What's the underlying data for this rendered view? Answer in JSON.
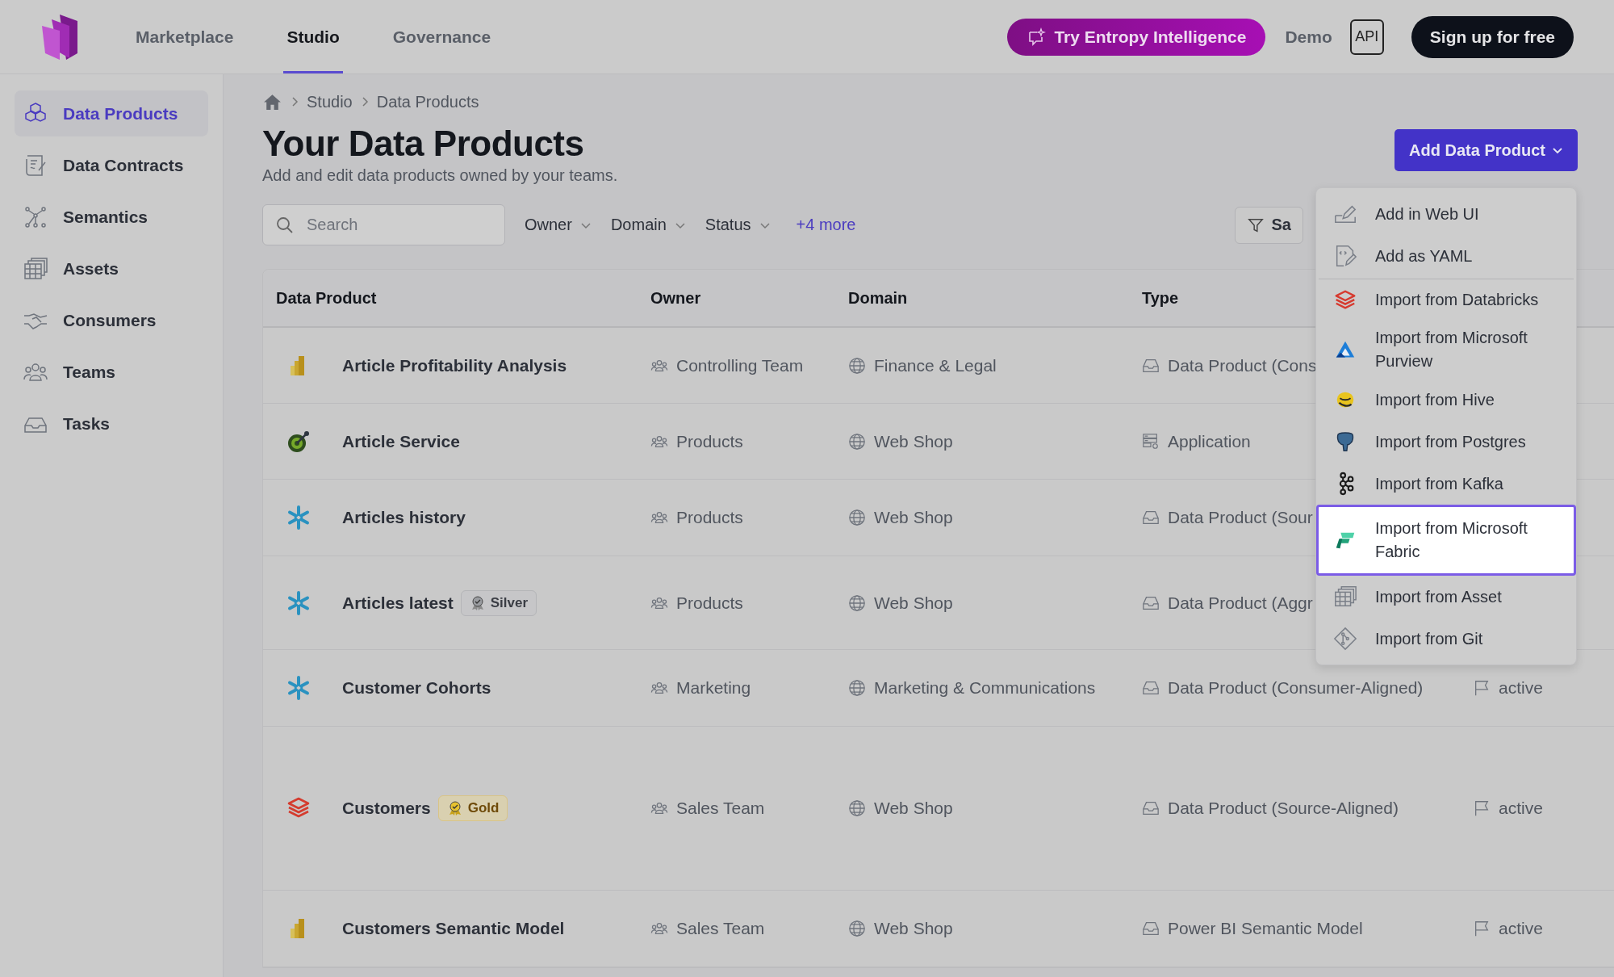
{
  "top_nav": {
    "tabs": [
      {
        "label": "Marketplace",
        "selected": false
      },
      {
        "label": "Studio",
        "selected": true
      },
      {
        "label": "Governance",
        "selected": false
      }
    ],
    "ai_button": "Try Entropy Intelligence",
    "demo_link": "Demo",
    "api_button": "API",
    "signup_button": "Sign up for free"
  },
  "sidebar": {
    "items": [
      {
        "label": "Data Products",
        "kind": "products",
        "selected": true
      },
      {
        "label": "Data Contracts",
        "kind": "contracts",
        "selected": false
      },
      {
        "label": "Semantics",
        "kind": "semantics",
        "selected": false
      },
      {
        "label": "Assets",
        "kind": "assets",
        "selected": false
      },
      {
        "label": "Consumers",
        "kind": "consumers",
        "selected": false
      },
      {
        "label": "Teams",
        "kind": "teams",
        "selected": false
      },
      {
        "label": "Tasks",
        "kind": "tasks",
        "selected": false
      }
    ]
  },
  "breadcrumb": [
    "Studio",
    "Data Products"
  ],
  "page": {
    "title": "Your Data Products",
    "subtitle": "Add and edit data products owned by your teams.",
    "add_button": "Add Data Product"
  },
  "filters": {
    "search_placeholder": "Search",
    "dropdowns": [
      "Owner",
      "Domain",
      "Status"
    ],
    "more_link": "+4 more",
    "saved_button": "Sa"
  },
  "table": {
    "columns": [
      "Data Product",
      "Owner",
      "Domain",
      "Type"
    ],
    "rows": [
      {
        "kind": "powerbi",
        "name": "Article Profitability Analysis",
        "owner": "Controlling Team",
        "domain": "Finance & Legal",
        "type": {
          "label": "Data Product (Cons",
          "kind": "data_product"
        }
      },
      {
        "kind": "gauge",
        "name": "Article Service",
        "owner": "Products",
        "domain": "Web Shop",
        "type": {
          "label": "Application",
          "kind": "application"
        }
      },
      {
        "kind": "snowflake",
        "name": "Articles history",
        "owner": "Products",
        "domain": "Web Shop",
        "type": {
          "label": "Data Product (Sour",
          "kind": "data_product"
        }
      },
      {
        "kind": "snowflake",
        "name": "Articles latest",
        "badge": {
          "label": "Silver",
          "kind": "silver"
        },
        "owner": "Products",
        "domain": "Web Shop",
        "type": {
          "label": "Data Product (Aggr",
          "kind": "data_product"
        }
      },
      {
        "kind": "snowflake",
        "name": "Customer Cohorts",
        "owner": "Marketing",
        "domain": "Marketing & Communications",
        "type": {
          "label": "Data Product (Consumer-Aligned)",
          "kind": "data_product"
        },
        "status": "active"
      },
      {
        "kind": "databricks",
        "name": "Customers",
        "badge": {
          "label": "Gold",
          "kind": "gold"
        },
        "owner": "Sales Team",
        "domain": "Web Shop",
        "type": {
          "label": "Data Product (Source-Aligned)",
          "kind": "data_product"
        },
        "status": "active"
      },
      {
        "kind": "powerbi",
        "name": "Customers Semantic Model",
        "owner": "Sales Team",
        "domain": "Web Shop",
        "type": {
          "label": "Power BI Semantic Model",
          "kind": "data_product"
        },
        "status": "active"
      }
    ]
  },
  "add_menu": {
    "items": [
      {
        "label": "Add in Web UI",
        "kind": "web_ui",
        "divider_above": false,
        "selected": false
      },
      {
        "label": "Add as YAML",
        "kind": "yaml",
        "divider_above": false,
        "selected": false
      },
      {
        "label": "Import from Databricks",
        "kind": "databricks",
        "divider_above": true,
        "selected": false
      },
      {
        "label": "Import from Microsoft Purview",
        "kind": "purview",
        "divider_above": false,
        "selected": false
      },
      {
        "label": "Import from Hive",
        "kind": "hive",
        "divider_above": false,
        "selected": false
      },
      {
        "label": "Import from Postgres",
        "kind": "postgres",
        "divider_above": false,
        "selected": false
      },
      {
        "label": "Import from Kafka",
        "kind": "kafka",
        "divider_above": false,
        "selected": false
      },
      {
        "label": "Import from Microsoft Fabric",
        "kind": "fabric",
        "divider_above": false,
        "selected": true
      },
      {
        "label": "Import from Asset",
        "kind": "asset",
        "divider_above": false,
        "selected": false
      },
      {
        "label": "Import from Git",
        "kind": "git",
        "divider_above": false,
        "selected": false
      }
    ]
  }
}
